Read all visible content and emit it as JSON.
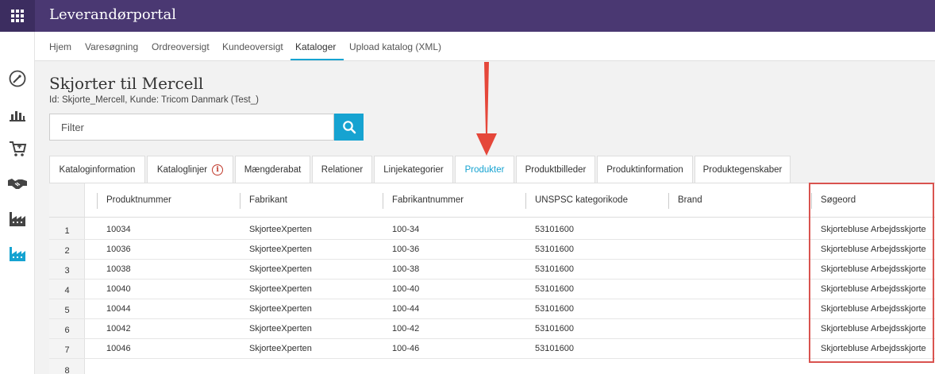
{
  "app": {
    "title": "Leverandørportal",
    "brand_color": "#4a3872",
    "accent_color": "#16a3d1"
  },
  "topbar": {
    "apps_icon": "grid-icon"
  },
  "sidebar": {
    "icons": [
      "dashboard-gauge-icon",
      "bar-chart-icon",
      "shopping-cart-icon",
      "handshake-icon",
      "factory-icon",
      "factory-active-icon"
    ]
  },
  "nav": {
    "items": [
      "Hjem",
      "Varesøgning",
      "Ordreoversigt",
      "Kundeoversigt",
      "Kataloger",
      "Upload katalog (XML)"
    ],
    "active": "Kataloger"
  },
  "page": {
    "title": "Skjorter til Mercell",
    "subtitle": "Id: Skjorte_Mercell, Kunde: Tricom Danmark (Test_)"
  },
  "filter": {
    "placeholder": "Filter",
    "value": ""
  },
  "tabs": {
    "items": [
      "Kataloginformation",
      "Kataloglinjer",
      "Mængderabat",
      "Relationer",
      "Linjekategorier",
      "Produkter",
      "Produktbilleder",
      "Produktinformation",
      "Produktegenskaber"
    ],
    "info_badge": "i",
    "active": "Produkter"
  },
  "table": {
    "columns": [
      "Produktnummer",
      "Fabrikant",
      "Fabrikantnummer",
      "UNSPSC kategorikode",
      "Brand",
      "Søgeord"
    ],
    "rows": [
      {
        "n": "1",
        "cells": [
          "10034",
          "SkjorteeXperten",
          "100-34",
          "53101600",
          "",
          "Skjortebluse Arbejdsskjorte"
        ]
      },
      {
        "n": "2",
        "cells": [
          "10036",
          "SkjorteeXperten",
          "100-36",
          "53101600",
          "",
          "Skjortebluse Arbejdsskjorte"
        ]
      },
      {
        "n": "3",
        "cells": [
          "10038",
          "SkjorteeXperten",
          "100-38",
          "53101600",
          "",
          "Skjortebluse Arbejdsskjorte"
        ]
      },
      {
        "n": "4",
        "cells": [
          "10040",
          "SkjorteeXperten",
          "100-40",
          "53101600",
          "",
          "Skjortebluse Arbejdsskjorte"
        ]
      },
      {
        "n": "5",
        "cells": [
          "10044",
          "SkjorteeXperten",
          "100-44",
          "53101600",
          "",
          "Skjortebluse Arbejdsskjorte"
        ]
      },
      {
        "n": "6",
        "cells": [
          "10042",
          "SkjorteeXperten",
          "100-42",
          "53101600",
          "",
          "Skjortebluse Arbejdsskjorte"
        ]
      },
      {
        "n": "7",
        "cells": [
          "10046",
          "SkjorteeXperten",
          "100-46",
          "53101600",
          "",
          "Skjortebluse Arbejdsskjorte"
        ]
      }
    ],
    "partial_row_number": "8"
  },
  "annotation": {
    "highlight_color": "#d9534f"
  }
}
